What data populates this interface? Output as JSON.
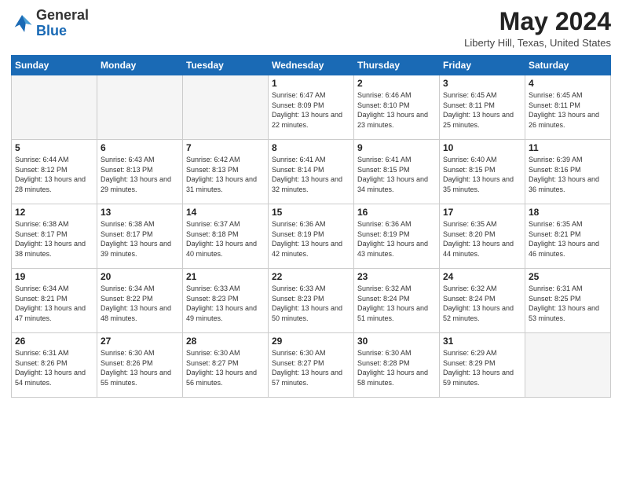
{
  "header": {
    "logo_general": "General",
    "logo_blue": "Blue",
    "month_title": "May 2024",
    "location": "Liberty Hill, Texas, United States"
  },
  "weekdays": [
    "Sunday",
    "Monday",
    "Tuesday",
    "Wednesday",
    "Thursday",
    "Friday",
    "Saturday"
  ],
  "weeks": [
    [
      {
        "day": "",
        "info": ""
      },
      {
        "day": "",
        "info": ""
      },
      {
        "day": "",
        "info": ""
      },
      {
        "day": "1",
        "info": "Sunrise: 6:47 AM\nSunset: 8:09 PM\nDaylight: 13 hours and 22 minutes."
      },
      {
        "day": "2",
        "info": "Sunrise: 6:46 AM\nSunset: 8:10 PM\nDaylight: 13 hours and 23 minutes."
      },
      {
        "day": "3",
        "info": "Sunrise: 6:45 AM\nSunset: 8:11 PM\nDaylight: 13 hours and 25 minutes."
      },
      {
        "day": "4",
        "info": "Sunrise: 6:45 AM\nSunset: 8:11 PM\nDaylight: 13 hours and 26 minutes."
      }
    ],
    [
      {
        "day": "5",
        "info": "Sunrise: 6:44 AM\nSunset: 8:12 PM\nDaylight: 13 hours and 28 minutes."
      },
      {
        "day": "6",
        "info": "Sunrise: 6:43 AM\nSunset: 8:13 PM\nDaylight: 13 hours and 29 minutes."
      },
      {
        "day": "7",
        "info": "Sunrise: 6:42 AM\nSunset: 8:13 PM\nDaylight: 13 hours and 31 minutes."
      },
      {
        "day": "8",
        "info": "Sunrise: 6:41 AM\nSunset: 8:14 PM\nDaylight: 13 hours and 32 minutes."
      },
      {
        "day": "9",
        "info": "Sunrise: 6:41 AM\nSunset: 8:15 PM\nDaylight: 13 hours and 34 minutes."
      },
      {
        "day": "10",
        "info": "Sunrise: 6:40 AM\nSunset: 8:15 PM\nDaylight: 13 hours and 35 minutes."
      },
      {
        "day": "11",
        "info": "Sunrise: 6:39 AM\nSunset: 8:16 PM\nDaylight: 13 hours and 36 minutes."
      }
    ],
    [
      {
        "day": "12",
        "info": "Sunrise: 6:38 AM\nSunset: 8:17 PM\nDaylight: 13 hours and 38 minutes."
      },
      {
        "day": "13",
        "info": "Sunrise: 6:38 AM\nSunset: 8:17 PM\nDaylight: 13 hours and 39 minutes."
      },
      {
        "day": "14",
        "info": "Sunrise: 6:37 AM\nSunset: 8:18 PM\nDaylight: 13 hours and 40 minutes."
      },
      {
        "day": "15",
        "info": "Sunrise: 6:36 AM\nSunset: 8:19 PM\nDaylight: 13 hours and 42 minutes."
      },
      {
        "day": "16",
        "info": "Sunrise: 6:36 AM\nSunset: 8:19 PM\nDaylight: 13 hours and 43 minutes."
      },
      {
        "day": "17",
        "info": "Sunrise: 6:35 AM\nSunset: 8:20 PM\nDaylight: 13 hours and 44 minutes."
      },
      {
        "day": "18",
        "info": "Sunrise: 6:35 AM\nSunset: 8:21 PM\nDaylight: 13 hours and 46 minutes."
      }
    ],
    [
      {
        "day": "19",
        "info": "Sunrise: 6:34 AM\nSunset: 8:21 PM\nDaylight: 13 hours and 47 minutes."
      },
      {
        "day": "20",
        "info": "Sunrise: 6:34 AM\nSunset: 8:22 PM\nDaylight: 13 hours and 48 minutes."
      },
      {
        "day": "21",
        "info": "Sunrise: 6:33 AM\nSunset: 8:23 PM\nDaylight: 13 hours and 49 minutes."
      },
      {
        "day": "22",
        "info": "Sunrise: 6:33 AM\nSunset: 8:23 PM\nDaylight: 13 hours and 50 minutes."
      },
      {
        "day": "23",
        "info": "Sunrise: 6:32 AM\nSunset: 8:24 PM\nDaylight: 13 hours and 51 minutes."
      },
      {
        "day": "24",
        "info": "Sunrise: 6:32 AM\nSunset: 8:24 PM\nDaylight: 13 hours and 52 minutes."
      },
      {
        "day": "25",
        "info": "Sunrise: 6:31 AM\nSunset: 8:25 PM\nDaylight: 13 hours and 53 minutes."
      }
    ],
    [
      {
        "day": "26",
        "info": "Sunrise: 6:31 AM\nSunset: 8:26 PM\nDaylight: 13 hours and 54 minutes."
      },
      {
        "day": "27",
        "info": "Sunrise: 6:30 AM\nSunset: 8:26 PM\nDaylight: 13 hours and 55 minutes."
      },
      {
        "day": "28",
        "info": "Sunrise: 6:30 AM\nSunset: 8:27 PM\nDaylight: 13 hours and 56 minutes."
      },
      {
        "day": "29",
        "info": "Sunrise: 6:30 AM\nSunset: 8:27 PM\nDaylight: 13 hours and 57 minutes."
      },
      {
        "day": "30",
        "info": "Sunrise: 6:30 AM\nSunset: 8:28 PM\nDaylight: 13 hours and 58 minutes."
      },
      {
        "day": "31",
        "info": "Sunrise: 6:29 AM\nSunset: 8:29 PM\nDaylight: 13 hours and 59 minutes."
      },
      {
        "day": "",
        "info": ""
      }
    ]
  ]
}
